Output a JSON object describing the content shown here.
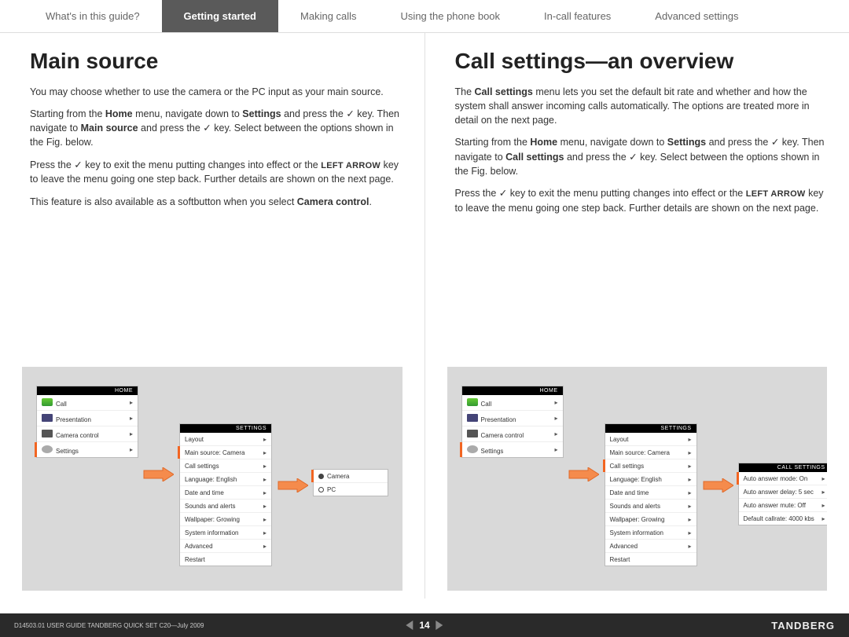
{
  "tabs": {
    "t0": "What's in this guide?",
    "t1": "Getting started",
    "t2": "Making calls",
    "t3": "Using the phone book",
    "t4": "In-call features",
    "t5": "Advanced settings"
  },
  "left": {
    "title": "Main source",
    "home_title": "HOME",
    "home": {
      "r0": "Call",
      "r1": "Presentation",
      "r2": "Camera control",
      "r3": "Settings"
    },
    "settings_title": "SETTINGS",
    "settings": {
      "r0": "Layout",
      "r1": "Main source: Camera",
      "r2": "Call settings",
      "r3": "Language: English",
      "r4": "Date and time",
      "r5": "Sounds and alerts",
      "r6": "Wallpaper: Growing",
      "r7": "System information",
      "r8": "Advanced",
      "r9": "Restart"
    },
    "opt0": "Camera",
    "opt1": "PC"
  },
  "right": {
    "title": "Call settings—an overview",
    "home_title": "HOME",
    "home": {
      "r0": "Call",
      "r1": "Presentation",
      "r2": "Camera control",
      "r3": "Settings"
    },
    "settings_title": "SETTINGS",
    "settings": {
      "r0": "Layout",
      "r1": "Main source: Camera",
      "r2": "Call settings",
      "r3": "Language: English",
      "r4": "Date and time",
      "r5": "Sounds and alerts",
      "r6": "Wallpaper: Growing",
      "r7": "System information",
      "r8": "Advanced",
      "r9": "Restart"
    },
    "cs_title": "CALL SETTINGS",
    "cs": {
      "r0": "Auto answer mode: On",
      "r1": "Auto answer delay: 5 sec",
      "r2": "Auto answer mute: Off",
      "r3": "Default callrate: 4000 kbs"
    }
  },
  "footer": {
    "docinfo": "D14503.01 USER GUIDE TANDBERG QUICK SET C20—July 2009",
    "page": "14",
    "brand": "TANDBERG"
  }
}
